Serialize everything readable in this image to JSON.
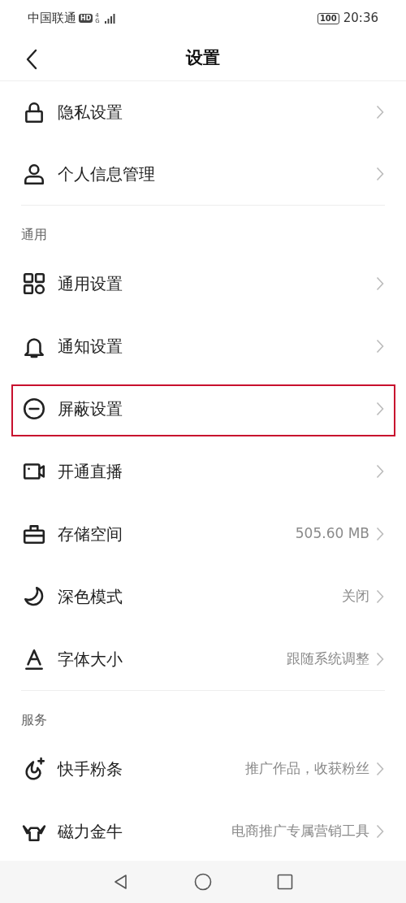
{
  "status_bar": {
    "carrier": "中国联通",
    "hd_badge": "HD",
    "network": "4G",
    "battery": "100",
    "time": "20:36"
  },
  "header": {
    "title": "设置"
  },
  "sections": [
    {
      "items": [
        {
          "label": "隐私设置",
          "highlighted": false
        },
        {
          "label": "个人信息管理",
          "highlighted": false
        }
      ]
    },
    {
      "header": "通用",
      "items": [
        {
          "label": "通用设置",
          "highlighted": false
        },
        {
          "label": "通知设置",
          "highlighted": false
        },
        {
          "label": "屏蔽设置",
          "highlighted": true
        },
        {
          "label": "开通直播",
          "highlighted": false
        },
        {
          "label": "存储空间",
          "value": "505.60 MB",
          "highlighted": false
        },
        {
          "label": "深色模式",
          "value": "关闭",
          "highlighted": false
        },
        {
          "label": "字体大小",
          "value": "跟随系统调整",
          "highlighted": false
        }
      ]
    },
    {
      "header": "服务",
      "items": [
        {
          "label": "快手粉条",
          "value": "推广作品，收获粉丝",
          "highlighted": false
        },
        {
          "label": "磁力金牛",
          "value": "电商推广专属营销工具",
          "highlighted": false
        }
      ]
    }
  ]
}
